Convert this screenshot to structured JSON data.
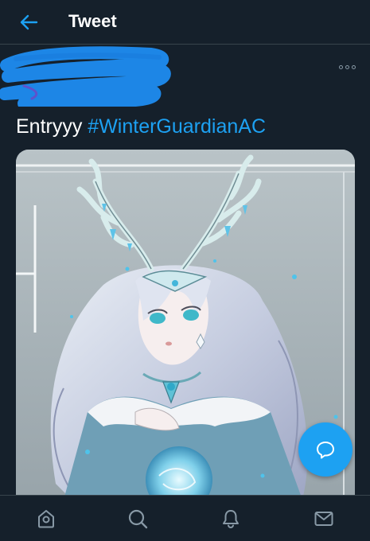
{
  "header": {
    "title": "Tweet",
    "back_icon": "arrow-left-icon"
  },
  "tweet": {
    "author_name_redacted": true,
    "text_plain": "Entryyy ",
    "hashtag": "#WinterGuardianAC",
    "more_icon": "more-horizontal-icon",
    "media_description_icon": "image-icon"
  },
  "fab": {
    "icon": "reply-bubble-icon"
  },
  "bottom_nav": {
    "items": [
      {
        "icon": "home-icon"
      },
      {
        "icon": "search-icon"
      },
      {
        "icon": "notifications-bell-icon"
      },
      {
        "icon": "messages-envelope-icon"
      }
    ]
  },
  "colors": {
    "background": "#15202b",
    "accent": "#1da1f2",
    "divider": "#38444d",
    "muted_icon": "#8899a6",
    "redaction": "#1d8cf0"
  }
}
